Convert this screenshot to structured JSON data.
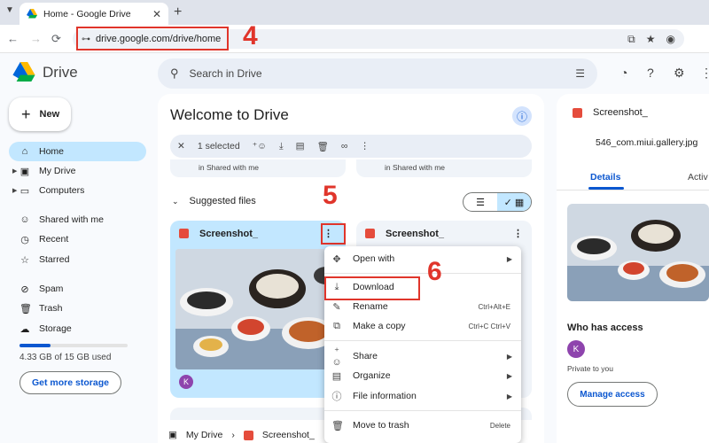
{
  "browser": {
    "tab_title": "Home - Google Drive",
    "url": "drive.google.com/drive/home"
  },
  "steps": [
    "4",
    "5",
    "6"
  ],
  "app": {
    "name": "Drive",
    "search_placeholder": "Search in Drive"
  },
  "sidebar": {
    "new_label": "New",
    "items": [
      {
        "label": "Home",
        "icon": "home-icon"
      },
      {
        "label": "My Drive",
        "icon": "my-drive-icon"
      },
      {
        "label": "Computers",
        "icon": "computers-icon"
      },
      {
        "label": "Shared with me",
        "icon": "people-icon"
      },
      {
        "label": "Recent",
        "icon": "clock-icon"
      },
      {
        "label": "Starred",
        "icon": "star-icon"
      },
      {
        "label": "Spam",
        "icon": "spam-icon"
      },
      {
        "label": "Trash",
        "icon": "trash-icon"
      },
      {
        "label": "Storage",
        "icon": "cloud-icon"
      }
    ],
    "storage_used_fraction": 0.29,
    "storage_text": "4.33 GB of 15 GB used",
    "get_more_label": "Get more storage"
  },
  "main": {
    "welcome": "Welcome to Drive",
    "selected_text": "1 selected",
    "quick_cards": [
      {
        "location": "in Shared with me"
      },
      {
        "location": "in Shared with me"
      }
    ],
    "suggested_label": "Suggested files",
    "files": [
      {
        "name": "Screenshot_"
      },
      {
        "name": "Screenshot_"
      }
    ],
    "owner_initial": "K",
    "breadcrumb": [
      "My Drive",
      "Screenshot_"
    ]
  },
  "context_menu": {
    "items": [
      {
        "label": "Open with",
        "icon": "move-icon",
        "submenu": true
      },
      {
        "label": "Download",
        "icon": "download-icon",
        "shortcut": ""
      },
      {
        "label": "Rename",
        "icon": "rename-icon",
        "shortcut": "Ctrl+Alt+E"
      },
      {
        "label": "Make a copy",
        "icon": "copy-icon",
        "shortcut": "Ctrl+C Ctrl+V"
      },
      {
        "label": "Share",
        "icon": "share-icon",
        "submenu": true
      },
      {
        "label": "Organize",
        "icon": "folder-icon",
        "submenu": true
      },
      {
        "label": "File information",
        "icon": "info-icon",
        "submenu": true
      },
      {
        "label": "Move to trash",
        "icon": "trash-icon",
        "shortcut": "Delete"
      }
    ]
  },
  "details_panel": {
    "title": "Screenshot_",
    "subtitle": "546_com.miui.gallery.jpg",
    "tabs": [
      "Details",
      "Activ"
    ],
    "who_has_access": "Who has access",
    "owner_initial": "K",
    "private_text": "Private to you",
    "manage_label": "Manage access"
  },
  "colors": {
    "accent": "#0b57d0",
    "selected": "#c2e7ff",
    "annotation_red": "#e0352b"
  }
}
